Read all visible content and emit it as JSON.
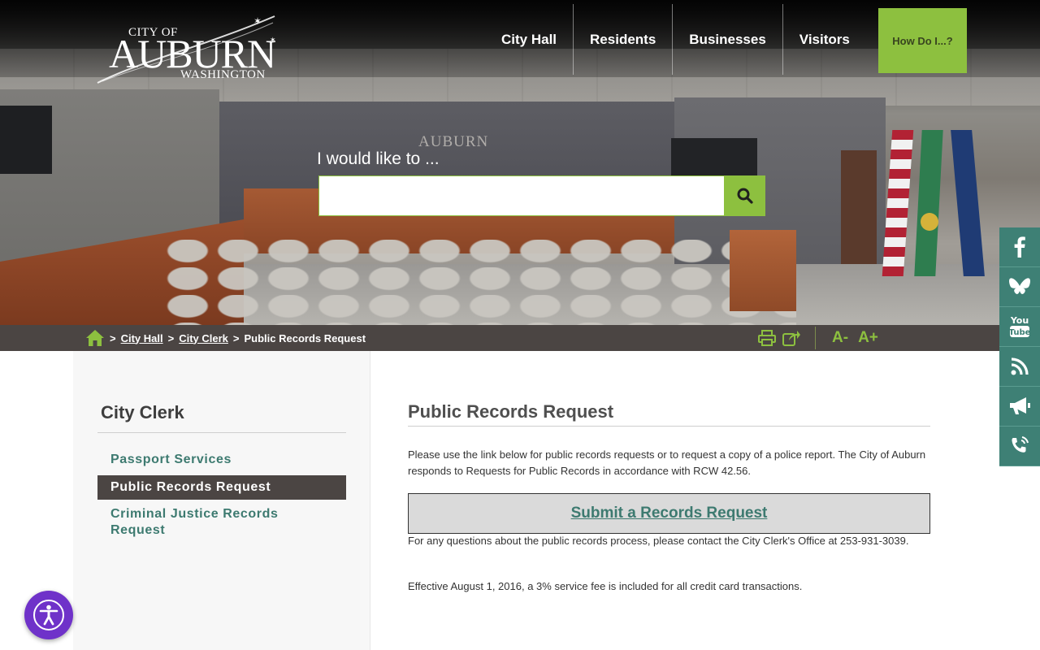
{
  "logo": {
    "city_of": "CITY OF",
    "name": "AUBURN",
    "state": "WASHINGTON"
  },
  "hero": {
    "wall_logo": "AUBURN"
  },
  "nav": {
    "items": [
      {
        "label": "City Hall"
      },
      {
        "label": "Residents"
      },
      {
        "label": "Businesses"
      },
      {
        "label": "Visitors"
      }
    ],
    "how_do_i": "How Do I...?"
  },
  "search": {
    "label": "I would like to ...",
    "placeholder": "",
    "value": ""
  },
  "breadcrumb": {
    "items": [
      {
        "label": "City Hall"
      },
      {
        "label": "City Clerk"
      }
    ],
    "current": "Public Records Request",
    "separator": ">"
  },
  "tools": {
    "font_smaller": "A-",
    "font_larger": "A+"
  },
  "social": [
    "facebook-icon",
    "bluesky-icon",
    "youtube-icon",
    "rss-icon",
    "megaphone-icon",
    "phone-icon"
  ],
  "sidebar": {
    "title": "City Clerk",
    "items": [
      {
        "label": "Passport Services",
        "active": false
      },
      {
        "label": "Public Records Request",
        "active": true
      },
      {
        "label": "Criminal Justice Records Request",
        "active": false
      }
    ]
  },
  "main": {
    "title": "Public Records Request",
    "intro": "Please use the link below for public records requests or to request a copy of a police report. The City of Auburn responds to Requests for Public Records in accordance with RCW 42.56.",
    "button_label": "Submit a Records Request",
    "contact": "For any questions about the public records process, please contact the City Clerk's Office at 253-931-3039.",
    "fee_notice": "Effective August 1, 2016, a 3% service fee is included for all credit card transactions."
  },
  "colors": {
    "accent_green": "#8dc03f",
    "teal": "#3e8075",
    "dark_bar": "#4b4543",
    "a11y_purple": "#6f32c9"
  }
}
